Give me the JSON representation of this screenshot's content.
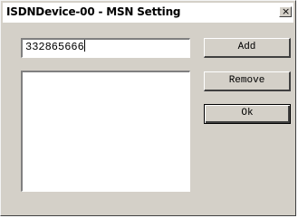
{
  "window": {
    "title": "ISDNDevice-00 - MSN Setting",
    "close_label": "×"
  },
  "msn_input": {
    "value": "332865666"
  },
  "buttons": {
    "add_label": "Add",
    "remove_label": "Remove",
    "ok_label": "Ok"
  },
  "msn_list": {
    "items": []
  },
  "colors": {
    "dialog_face": "#d4d0c8",
    "field_background": "#ffffff",
    "shadow": "#808080",
    "dark_shadow": "#404040"
  },
  "icons": {
    "close": "close-icon"
  }
}
